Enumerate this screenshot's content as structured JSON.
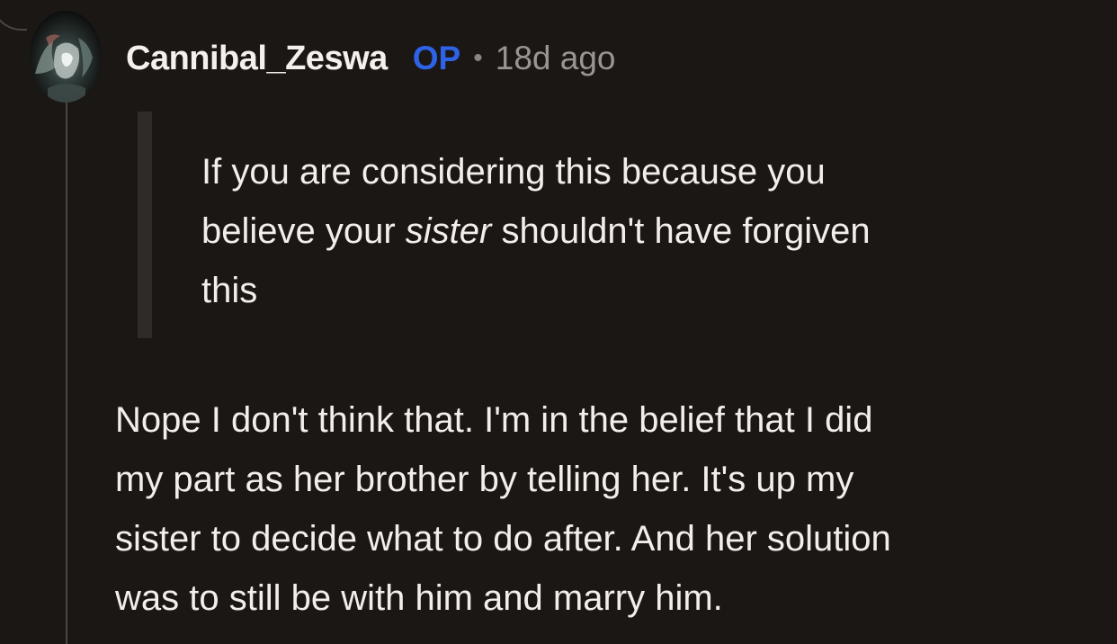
{
  "comment": {
    "author": "Cannibal_Zeswa",
    "badge": "OP",
    "separator": "•",
    "timestamp": "18d ago",
    "quote": {
      "line1": "If you are considering this because you",
      "line2_before": "believe your ",
      "line2_emphasis": "sister",
      "line2_after": " shouldn't have forgiven",
      "line3": "this"
    },
    "body": {
      "line1": "Nope I don't think that. I'm in the belief that I did",
      "line2": "my part as her brother by telling her. It's up my",
      "line3": "sister to decide what to do after. And her solution",
      "line4": "was to still be with him and marry him."
    }
  },
  "icons": {
    "avatar": "user-avatar-icon"
  },
  "colors": {
    "background": "#1a1715",
    "text": "#f2eeea",
    "op_badge": "#2e63e8",
    "muted": "#9b958f",
    "quote_bar": "#2f2b29",
    "thread_line": "#4a4542"
  }
}
